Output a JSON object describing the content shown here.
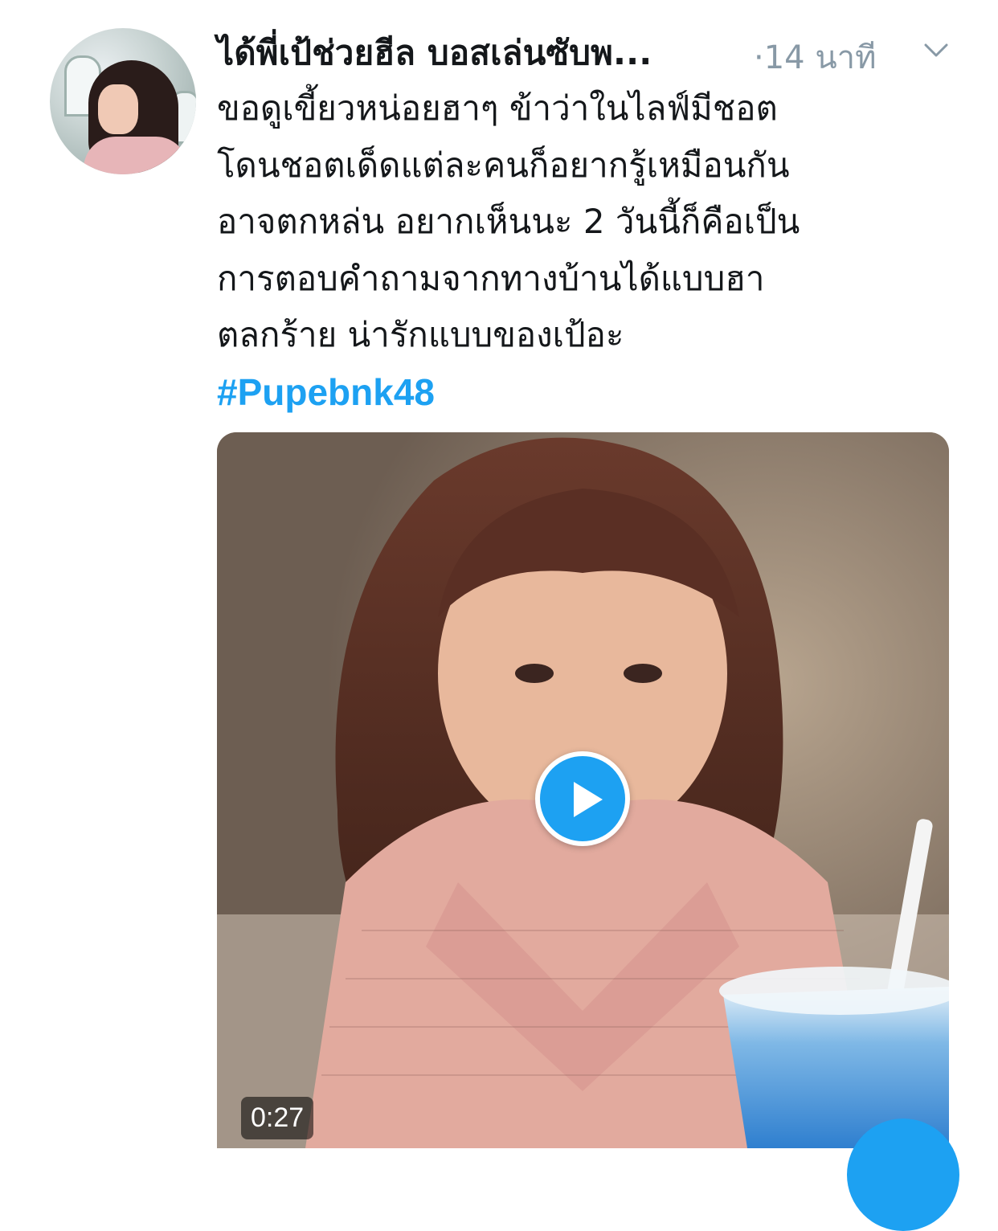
{
  "tweet": {
    "display_name": "ได้พี่เป้ช่วยฮีล บอสเล่นซับพ...",
    "time_ago": "·14 นาที",
    "body_lines": [
      "ขอดูเขี้ยวหน่อยฮาๆ ข้าว่าในไลฟ์มีชอต",
      "โดนชอตเด็ดแต่ละคนก็อยากรู้เหมือนกัน",
      "อาจตกหล่น อยากเห็นนะ 2 วันนี้ก็คือเป็น",
      "การตอบคำถามจากทางบ้านได้แบบฮา",
      "ตลกร้าย น่ารักแบบของเป้อะ"
    ],
    "hashtag": "#Pupebnk48"
  },
  "media": {
    "duration": "0:27"
  },
  "icons": {
    "chevron": "chevron-down-icon",
    "play": "play-icon"
  },
  "colors": {
    "accent": "#1da1f2",
    "text": "#14171a",
    "muted": "#8899a6"
  }
}
